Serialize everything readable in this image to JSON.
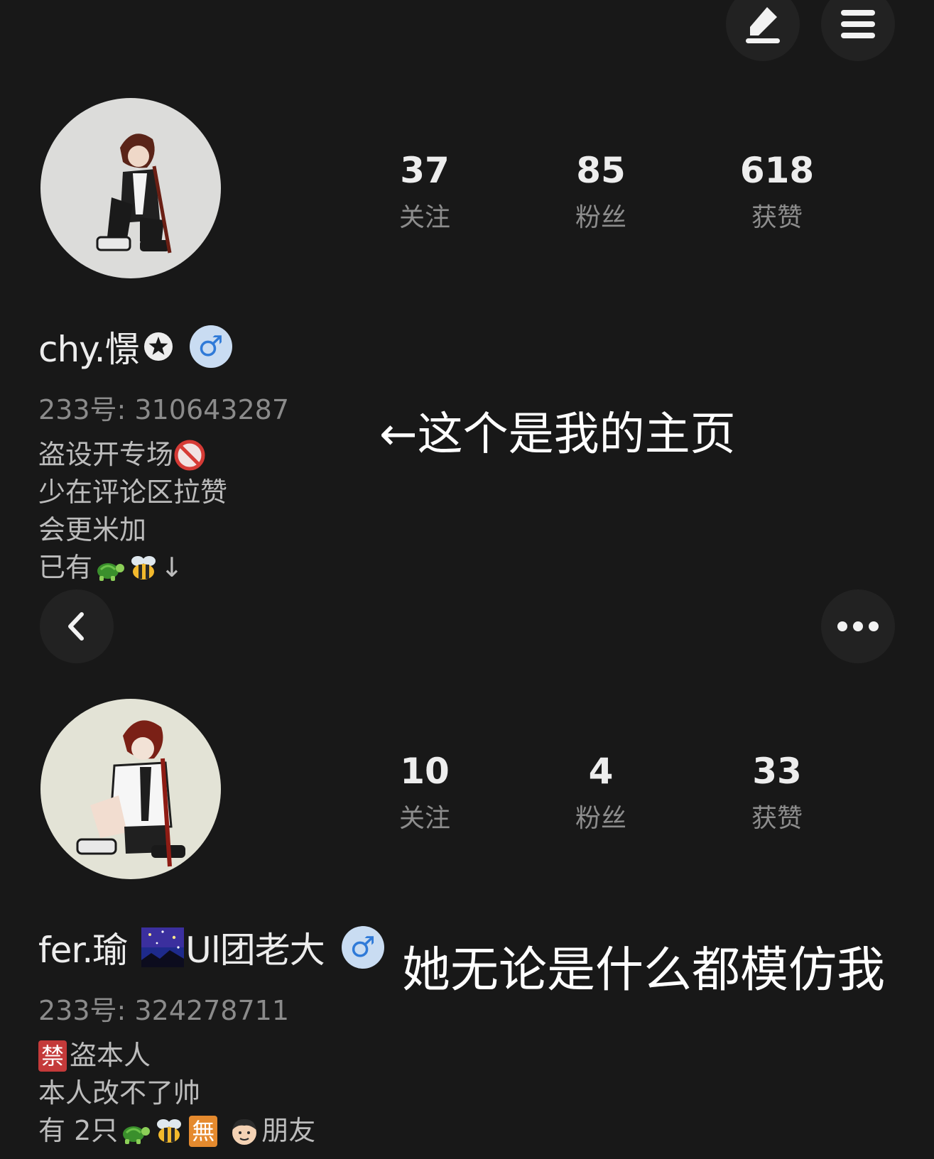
{
  "top_bar": {
    "edit_icon": "pencil-icon",
    "menu_icon": "hamburger-menu-icon"
  },
  "profile_1": {
    "stats": [
      {
        "value": "37",
        "label": "关注"
      },
      {
        "value": "85",
        "label": "粉丝"
      },
      {
        "value": "618",
        "label": "获赞"
      }
    ],
    "name": "chy.憬",
    "name_badge_icon": "star-circle-icon",
    "gender_symbol": "♂",
    "user_id": "233号: 310643287",
    "bio": {
      "line1": "盗设开专场",
      "line1_icon": "prohibited-icon",
      "line2": "少在评论区拉赞",
      "line3": "会更米加",
      "line4_prefix": "已有",
      "line4_icons": [
        "turtle-icon",
        "bee-icon"
      ],
      "line4_suffix": "↓"
    }
  },
  "annotation_1": "←这个是我的主页",
  "nav_bar": {
    "back_icon": "chevron-left-icon",
    "more_icon": "more-dots-icon"
  },
  "profile_2": {
    "stats": [
      {
        "value": "10",
        "label": "关注"
      },
      {
        "value": "4",
        "label": "粉丝"
      },
      {
        "value": "33",
        "label": "获赞"
      }
    ],
    "name": "fer.瑜",
    "name_image_icon": "starry-night-icon",
    "name_suffix": "Ul团老大",
    "gender_symbol": "♂",
    "user_id": "233号: 324278711",
    "bio": {
      "line1_badge": "禁",
      "line1": "盗本人",
      "line2": "本人改不了帅",
      "line3_prefix": "有 2只",
      "line3_icons": [
        "turtle-icon",
        "bee-icon"
      ],
      "line3_badge": "無",
      "line3_face_icon": "boy-face-icon",
      "line3_suffix": "朋友"
    }
  },
  "annotation_2": "她无论是什么都模仿我"
}
